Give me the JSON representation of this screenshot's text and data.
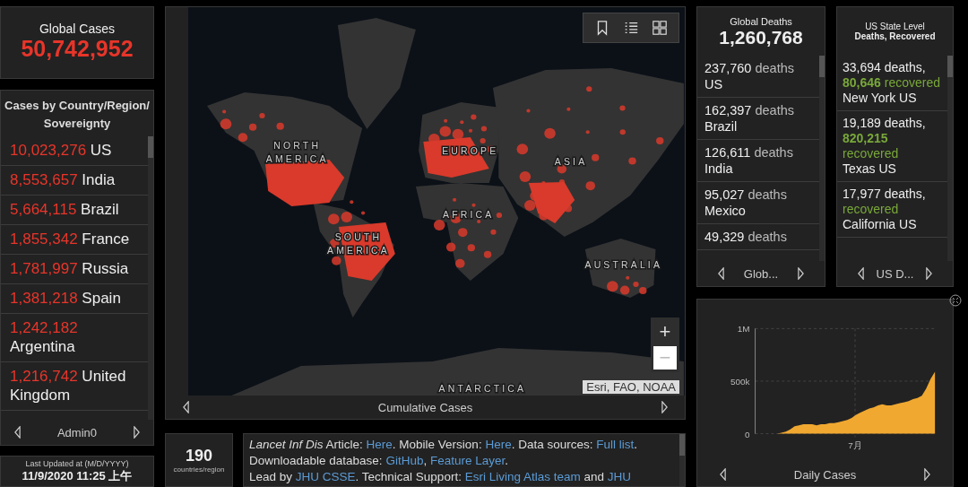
{
  "global_cases": {
    "title": "Global Cases",
    "value": "50,742,952"
  },
  "cases_by_country": {
    "title": "Cases by Country/Region/Sovereignty",
    "items": [
      {
        "count": "10,023,276",
        "place": "US"
      },
      {
        "count": "8,553,657",
        "place": "India"
      },
      {
        "count": "5,664,115",
        "place": "Brazil"
      },
      {
        "count": "1,855,342",
        "place": "France"
      },
      {
        "count": "1,781,997",
        "place": "Russia"
      },
      {
        "count": "1,381,218",
        "place": "Spain"
      },
      {
        "count": "1,242,182",
        "place": "Argentina"
      },
      {
        "count": "1,216,742",
        "place": "United Kingdom"
      }
    ],
    "nav_label": "Admin0"
  },
  "last_updated": {
    "label": "Last Updated at (M/D/YYYY)",
    "value": "11/9/2020 11:25 上午"
  },
  "map": {
    "labels": [
      {
        "lines": [
          "NORTH",
          "AMERICA"
        ]
      },
      {
        "lines": [
          "EUROPE"
        ]
      },
      {
        "lines": [
          "ASIA"
        ]
      },
      {
        "lines": [
          "AFRICA"
        ]
      },
      {
        "lines": [
          "SOUTH",
          "AMERICA"
        ]
      },
      {
        "lines": [
          "AUSTRALIA"
        ]
      },
      {
        "lines": [
          "ANTARCTICA"
        ]
      }
    ],
    "zoom_in": "+",
    "zoom_out": "−",
    "attribution": "Esri, FAO, NOAA",
    "nav_label": "Cumulative Cases"
  },
  "country_count": {
    "value": "190",
    "caption": "countries/region"
  },
  "info": {
    "paragraphs": [
      [
        {
          "kind": "italic",
          "text": "Lancet Inf Dis"
        },
        {
          "kind": "plain",
          "text": " Article: "
        },
        {
          "kind": "link",
          "text": "Here"
        },
        {
          "kind": "plain",
          "text": ". Mobile Version: "
        },
        {
          "kind": "link",
          "text": "Here"
        },
        {
          "kind": "plain",
          "text": ". Data sources: "
        },
        {
          "kind": "link",
          "text": "Full list"
        },
        {
          "kind": "plain",
          "text": ". Downloadable database: "
        },
        {
          "kind": "link",
          "text": "GitHub"
        },
        {
          "kind": "plain",
          "text": ", "
        },
        {
          "kind": "link",
          "text": "Feature Layer"
        },
        {
          "kind": "plain",
          "text": "."
        }
      ],
      [
        {
          "kind": "plain",
          "text": "Lead by "
        },
        {
          "kind": "link",
          "text": "JHU CSSE"
        },
        {
          "kind": "plain",
          "text": ". Technical Support: "
        },
        {
          "kind": "link",
          "text": "Esri Living Atlas team"
        },
        {
          "kind": "plain",
          "text": " and "
        },
        {
          "kind": "link",
          "text": "JHU"
        }
      ]
    ]
  },
  "global_deaths": {
    "title": "Global Deaths",
    "value": "1,260,768",
    "items": [
      {
        "count": "237,760",
        "unit": "deaths",
        "place": "US"
      },
      {
        "count": "162,397",
        "unit": "deaths",
        "place": "Brazil"
      },
      {
        "count": "126,611",
        "unit": "deaths",
        "place": "India"
      },
      {
        "count": "95,027",
        "unit": "deaths",
        "place": "Mexico"
      },
      {
        "count": "49,329",
        "unit": "deaths"
      }
    ],
    "nav_label": "Glob..."
  },
  "us_states": {
    "title": "US State Level",
    "subtitle": "Deaths, Recovered",
    "items": [
      {
        "count": "33,694",
        "unit": "deaths,",
        "recovered": "80,646",
        "recovered_label": "recovered",
        "place": "New York US"
      },
      {
        "count": "19,189",
        "unit": "deaths,",
        "recovered": "820,215",
        "recovered_label": "recovered",
        "place": "Texas US"
      },
      {
        "count": "17,977",
        "unit": "deaths,",
        "recovered_label": "recovered",
        "place": "California US"
      }
    ],
    "nav_label": "US D..."
  },
  "daily_chart": {
    "nav_label": "Daily Cases",
    "chart_data": {
      "type": "area",
      "series": [
        {
          "color": "#f0a830",
          "values": [
            0,
            0,
            0,
            0,
            0,
            0,
            10000,
            20000,
            40000,
            70000,
            80000,
            90000,
            90000,
            90000,
            80000,
            90000,
            90000,
            100000,
            100000,
            110000,
            120000,
            130000,
            150000,
            180000,
            200000,
            220000,
            240000,
            250000,
            270000,
            280000,
            270000,
            270000,
            280000,
            290000,
            300000,
            310000,
            330000,
            340000,
            360000,
            430000,
            520000,
            590000
          ]
        }
      ],
      "ylim": [
        0,
        1000000
      ],
      "annotations": [
        "7月"
      ],
      "yticks": [
        {
          "value": 0,
          "label": "0"
        },
        {
          "value": 500000,
          "label": "500k"
        },
        {
          "value": 1000000,
          "label": "1M"
        }
      ]
    }
  }
}
